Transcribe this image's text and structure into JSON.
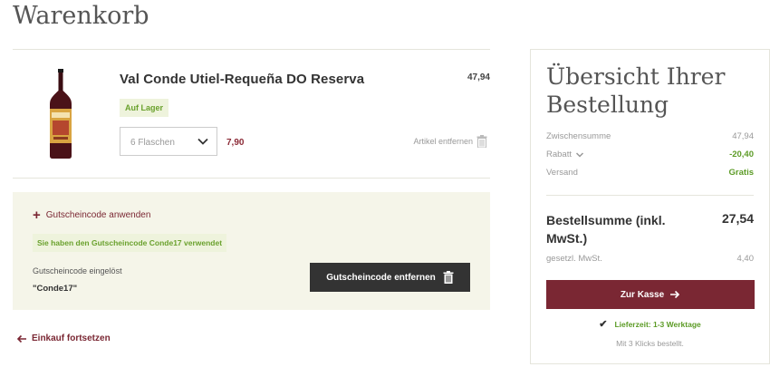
{
  "page": {
    "title": "Warenkorb"
  },
  "cart": {
    "item": {
      "name": "Val Conde Utiel-Requeña DO Reserva",
      "price": "47,94",
      "stock": "Auf Lager",
      "quantity": "6 Flaschen",
      "unit_price": "7,90",
      "remove_label": "Artikel entfernen"
    }
  },
  "voucher": {
    "toggle_label": "Gutscheincode anwenden",
    "success_message": "Sie haben den Gutscheincode Conde17 verwendet",
    "redeemed_label": "Gutscheincode eingelöst",
    "code": "\"Conde17\"",
    "remove_button": "Gutscheincode entfernen"
  },
  "continue_shopping": "Einkauf fortsetzen",
  "summary": {
    "title": "Übersicht Ihrer Bestellung",
    "subtotal_label": "Zwischensumme",
    "subtotal_value": "47,94",
    "discount_label": "Rabatt",
    "discount_value": "-20,40",
    "shipping_label": "Versand",
    "shipping_value": "Gratis",
    "total_label": "Bestellsumme (inkl. MwSt.)",
    "total_value": "27,54",
    "vat_label": "gesetzl. MwSt.",
    "vat_value": "4,40",
    "checkout_button": "Zur Kasse",
    "delivery_time": "Lieferzeit: 1-3 Werktage",
    "clicks_note": "Mit 3 Klicks bestellt."
  },
  "colors": {
    "brand": "#7a2733",
    "success": "#5c9b26",
    "dark_button": "#333333"
  }
}
